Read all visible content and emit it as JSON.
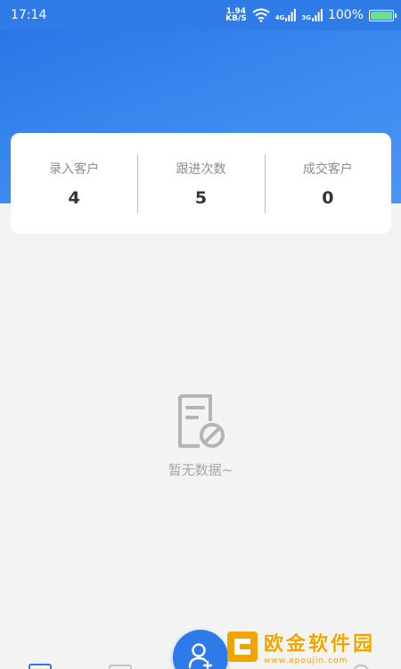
{
  "status_bar": {
    "time": "17:14",
    "net_speed_value": "1.94",
    "net_speed_unit": "KB/S",
    "signal_1": "4G",
    "signal_2": "3G",
    "battery_text": "100%",
    "battery_level": 1.0
  },
  "stats": [
    {
      "label": "录入客户",
      "value": "4"
    },
    {
      "label": "跟进次数",
      "value": "5"
    },
    {
      "label": "成交客户",
      "value": "0"
    }
  ],
  "empty_state": {
    "icon": "document-blocked-icon",
    "text": "暂无数据~"
  },
  "fab": {
    "icon": "add-user-icon"
  },
  "watermark": {
    "title": "欧金软件园",
    "url": "www.apoujin.com"
  },
  "colors": {
    "primary": "#2d7ae8",
    "header_gradient_end": "#4b95f4",
    "background": "#f3f3f4",
    "watermark": "#f0a400"
  }
}
